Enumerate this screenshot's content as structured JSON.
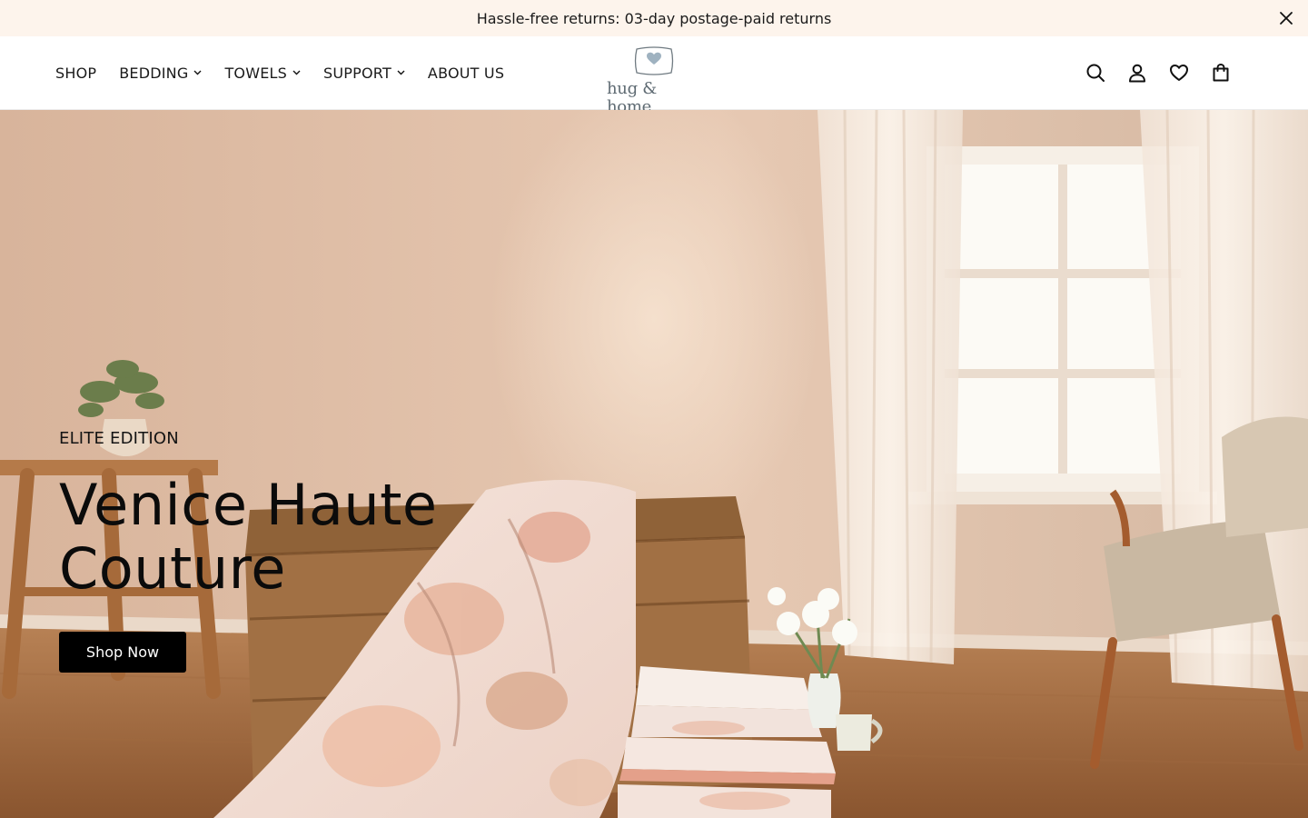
{
  "announcement": {
    "text": "Hassle-free returns: 03-day postage-paid returns",
    "close_icon": "close-icon"
  },
  "nav": {
    "items": [
      {
        "label": "SHOP",
        "has_dropdown": false
      },
      {
        "label": "BEDDING",
        "has_dropdown": true
      },
      {
        "label": "TOWELS",
        "has_dropdown": true
      },
      {
        "label": "SUPPORT",
        "has_dropdown": true
      },
      {
        "label": "ABOUT US",
        "has_dropdown": false
      }
    ]
  },
  "logo": {
    "wordmark": "hug & home",
    "icon": "pillow-heart-icon"
  },
  "header_icons": [
    "search-icon",
    "account-icon",
    "wishlist-icon",
    "cart-icon"
  ],
  "hero": {
    "eyebrow": "ELITE EDITION",
    "title": "Venice Haute Couture",
    "cta_label": "Shop Now"
  },
  "colors": {
    "announcement_bg": "#fdf4ec",
    "cta_bg": "#000000",
    "cta_text": "#ffffff",
    "logo_gray": "#5f6b73"
  }
}
